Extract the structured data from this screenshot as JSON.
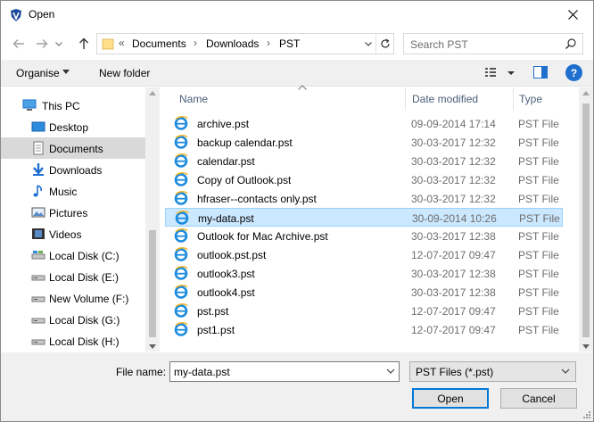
{
  "window": {
    "title": "Open"
  },
  "address": {
    "overflow": "«",
    "crumbs": [
      "Documents",
      "Downloads",
      "PST"
    ],
    "separator": "›"
  },
  "search": {
    "placeholder": "Search PST"
  },
  "toolbar": {
    "organise": "Organise",
    "new_folder": "New folder",
    "help": "?"
  },
  "nav": {
    "items": [
      {
        "label": "This PC",
        "icon": "this-pc-icon"
      },
      {
        "label": "Desktop",
        "icon": "desktop-icon"
      },
      {
        "label": "Documents",
        "icon": "documents-icon",
        "selected": true
      },
      {
        "label": "Downloads",
        "icon": "downloads-icon"
      },
      {
        "label": "Music",
        "icon": "music-icon"
      },
      {
        "label": "Pictures",
        "icon": "pictures-icon"
      },
      {
        "label": "Videos",
        "icon": "videos-icon"
      },
      {
        "label": "Local Disk (C:)",
        "icon": "drive-icon"
      },
      {
        "label": "Local Disk (E:)",
        "icon": "drive-icon"
      },
      {
        "label": "New Volume (F:)",
        "icon": "drive-icon"
      },
      {
        "label": "Local Disk (G:)",
        "icon": "drive-icon"
      },
      {
        "label": "Local Disk (H:)",
        "icon": "drive-icon"
      }
    ]
  },
  "columns": {
    "name": "Name",
    "date": "Date modified",
    "type": "Type"
  },
  "files": [
    {
      "name": "archive.pst",
      "date": "09-09-2014 17:14",
      "type": "PST File"
    },
    {
      "name": "backup calendar.pst",
      "date": "30-03-2017 12:32",
      "type": "PST File"
    },
    {
      "name": "calendar.pst",
      "date": "30-03-2017 12:32",
      "type": "PST File"
    },
    {
      "name": "Copy of Outlook.pst",
      "date": "30-03-2017 12:32",
      "type": "PST File"
    },
    {
      "name": "hfraser--contacts only.pst",
      "date": "30-03-2017 12:32",
      "type": "PST File"
    },
    {
      "name": "my-data.pst",
      "date": "30-09-2014 10:26",
      "type": "PST File",
      "selected": true
    },
    {
      "name": "Outlook for Mac Archive.pst",
      "date": "30-03-2017 12:38",
      "type": "PST File"
    },
    {
      "name": "outlook.pst.pst",
      "date": "12-07-2017 09:47",
      "type": "PST File"
    },
    {
      "name": "outlook3.pst",
      "date": "30-03-2017 12:38",
      "type": "PST File"
    },
    {
      "name": "outlook4.pst",
      "date": "30-03-2017 12:38",
      "type": "PST File"
    },
    {
      "name": "pst.pst",
      "date": "12-07-2017 09:47",
      "type": "PST File"
    },
    {
      "name": "pst1.pst",
      "date": "12-07-2017 09:47",
      "type": "PST File"
    }
  ],
  "filename": {
    "label": "File name:",
    "value": "my-data.pst"
  },
  "filetype": {
    "value": "PST Files (*.pst)"
  },
  "buttons": {
    "open": "Open",
    "cancel": "Cancel"
  },
  "colors": {
    "accent": "#0078d7",
    "selection": "#cce8ff",
    "selection_border": "#99d1ff",
    "nav_selected": "#d9d9d9",
    "header_text": "#4c607a"
  }
}
